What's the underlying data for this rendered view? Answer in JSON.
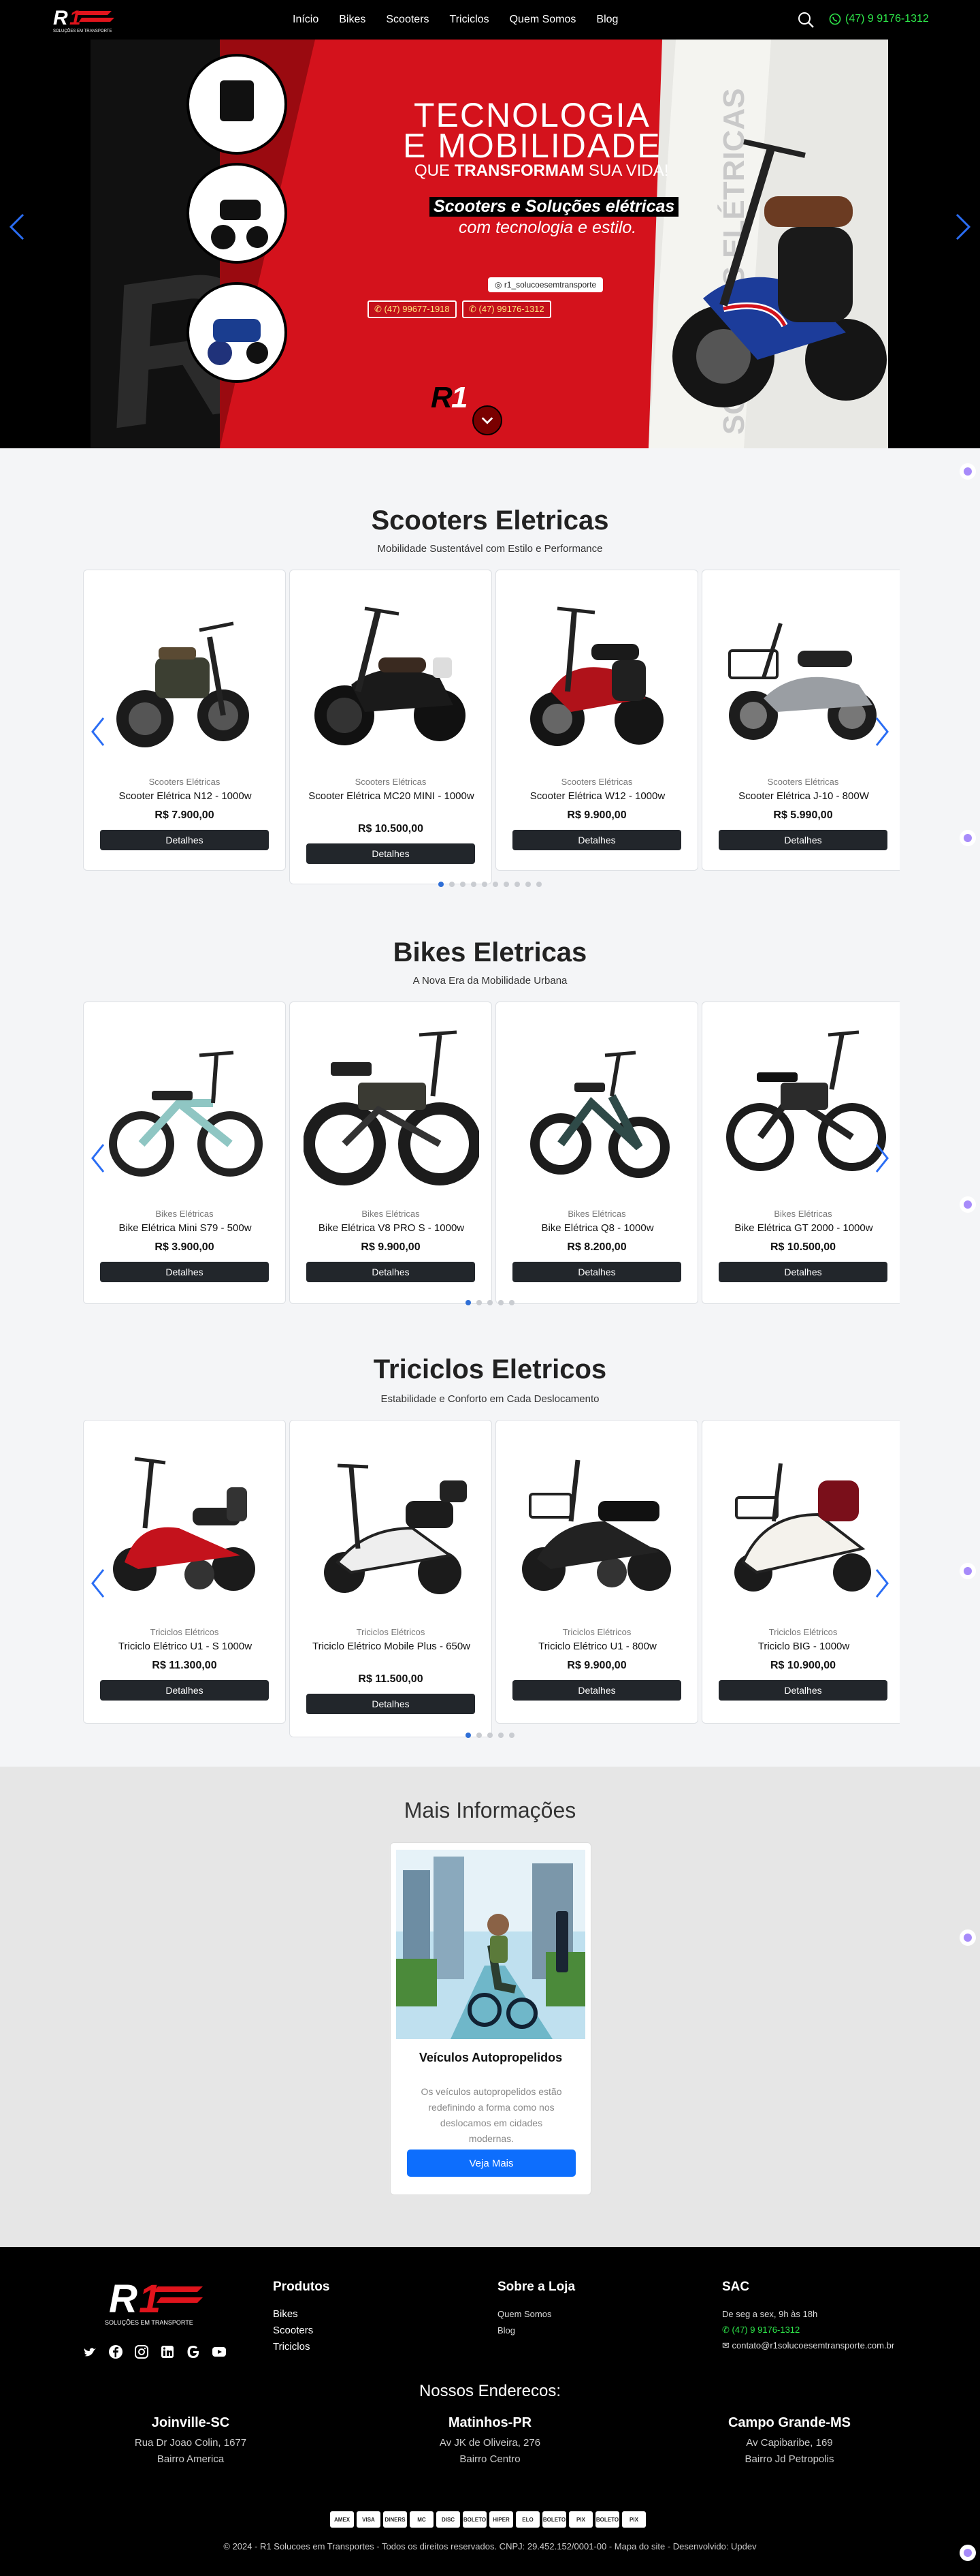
{
  "nav": {
    "links": [
      "Início",
      "Bikes",
      "Scooters",
      "Triciclos",
      "Quem Somos",
      "Blog"
    ],
    "phone": "(47) 9 9176-1312",
    "logo_text": "SOLUÇÕES EM TRANSPORTE"
  },
  "hero": {
    "title_line1": "TECNOLOGIA",
    "title_line2": "E MOBILIDADE",
    "sub_pre": "QUE ",
    "sub_bold": "TRANSFORMAM",
    "sub_post": " SUA VIDA!",
    "tag1": "Scooters e Soluções elétricas",
    "tag2": "com tecnologia e estilo.",
    "instagram": "r1_solucoesemtransporte",
    "phone1": "(47) 99677-1918",
    "phone2": "(47) 99176-1312",
    "side_text": "SCOOTERS ELÉTRICAS"
  },
  "sections": [
    {
      "title": "Scooters Eletricas",
      "subtitle": "Mobilidade Sustentável com Estilo e Performance",
      "products": [
        {
          "category": "Scooters Elétricas",
          "name": "Scooter Elétrica N12 - 1000w",
          "price": "R$ 7.900,00"
        },
        {
          "category": "Scooters Elétricas",
          "name": "Scooter Elétrica MC20 MINI - 1000w",
          "price": "R$ 10.500,00"
        },
        {
          "category": "Scooters Elétricas",
          "name": "Scooter Elétrica W12 - 1000w",
          "price": "R$ 9.900,00"
        },
        {
          "category": "Scooters Elétricas",
          "name": "Scooter Elétrica J-10 - 800W",
          "price": "R$ 5.990,00"
        }
      ],
      "button": "Detalhes",
      "dots": 10
    },
    {
      "title": "Bikes Eletricas",
      "subtitle": "A Nova Era da Mobilidade Urbana",
      "products": [
        {
          "category": "Bikes Elétricas",
          "name": "Bike Elétrica Mini S79 - 500w",
          "price": "R$ 3.900,00"
        },
        {
          "category": "Bikes Elétricas",
          "name": "Bike Elétrica V8 PRO S - 1000w",
          "price": "R$ 9.900,00"
        },
        {
          "category": "Bikes Elétricas",
          "name": "Bike Elétrica Q8 - 1000w",
          "price": "R$ 8.200,00"
        },
        {
          "category": "Bikes Elétricas",
          "name": "Bike Elétrica GT 2000 - 1000w",
          "price": "R$ 10.500,00"
        }
      ],
      "button": "Detalhes",
      "dots": 5
    },
    {
      "title": "Triciclos Eletricos",
      "subtitle": "Estabilidade e Conforto em Cada Deslocamento",
      "products": [
        {
          "category": "Triciclos Elétricos",
          "name": "Triciclo Elétrico U1 - S 1000w",
          "price": "R$ 11.300,00"
        },
        {
          "category": "Triciclos Elétricos",
          "name": "Triciclo Elétrico Mobile Plus - 650w",
          "price": "R$ 11.500,00"
        },
        {
          "category": "Triciclos Elétricos",
          "name": "Triciclo Elétrico U1 - 800w",
          "price": "R$ 9.900,00"
        },
        {
          "category": "Triciclos Elétricos",
          "name": "Triciclo BIG - 1000w",
          "price": "R$ 10.900,00"
        }
      ],
      "button": "Detalhes",
      "dots": 5
    }
  ],
  "info": {
    "title": "Mais Informações",
    "card_title": "Veículos Autopropelidos",
    "card_text": "Os veículos autopropelidos estão redefinindo a forma como nos deslocamos em cidades modernas.",
    "button": "Veja Mais"
  },
  "footer": {
    "logo_text": "SOLUÇÕES EM TRANSPORTE",
    "produtos_title": "Produtos",
    "produtos": [
      "Bikes",
      "Scooters",
      "Triciclos"
    ],
    "sobre_title": "Sobre a Loja",
    "sobre": [
      "Quem Somos",
      "Blog"
    ],
    "sac_title": "SAC",
    "sac_hours": "De seg a sex, 9h às 18h",
    "sac_phone": "(47) 9 9176-1312",
    "sac_email": "contato@r1solucoesemtransporte.com.br",
    "addresses_title": "Nossos Enderecos:",
    "addresses": [
      {
        "city": "Joinville-SC",
        "street": "Rua Dr Joao Colin, 1677",
        "district": "Bairro America"
      },
      {
        "city": "Matinhos-PR",
        "street": "Av JK de Oliveira, 276",
        "district": "Bairro Centro"
      },
      {
        "city": "Campo Grande-MS",
        "street": "Av Capibaribe, 169",
        "district": "Bairro Jd Petropolis"
      }
    ],
    "payments": [
      "AMEX",
      "VISA",
      "DINERS",
      "MC",
      "DISC",
      "BOLETO",
      "HIPER",
      "ELO",
      "BOLETO",
      "PIX",
      "BOLETO",
      "PIX"
    ],
    "copyright": "© 2024 - R1 Solucoes em Transportes - Todos os direitos reservados. CNPJ: 29.452.152/0001-00 - Mapa do site - Desenvolvido: Updev"
  },
  "colors": {
    "accent_green": "#2ee84a",
    "banner_red": "#d4121c",
    "button_dark": "#22262b",
    "button_blue": "#0d6efd",
    "dot_active": "#2f6fd6"
  }
}
